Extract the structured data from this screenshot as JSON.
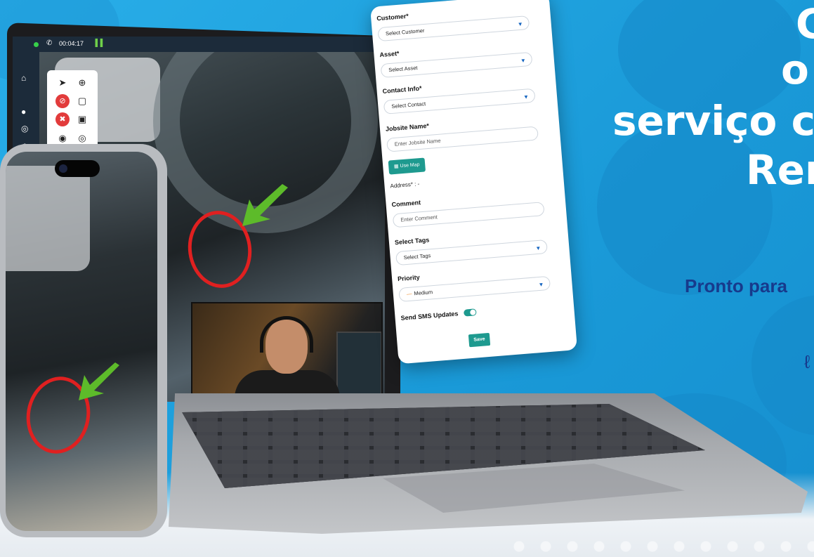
{
  "headline": {
    "line1": "C",
    "line2": "o",
    "line3": "serviço c",
    "line4": "Rer"
  },
  "subheadline": "Pronto para",
  "call": {
    "timer": "00:04:17"
  },
  "form": {
    "customer": {
      "label": "Customer*",
      "value": "Select Customer"
    },
    "asset": {
      "label": "Asset*",
      "value": "Select Asset"
    },
    "contact": {
      "label": "Contact Info*",
      "value": "Select Contact"
    },
    "jobsite": {
      "label": "Jobsite Name*",
      "placeholder": "Enter Jobsite Name"
    },
    "use_map_label": "Use Map",
    "address_text": "Address* : -",
    "comment": {
      "label": "Comment",
      "placeholder": "Enter Comment"
    },
    "tags": {
      "label": "Select Tags",
      "value": "Select Tags"
    },
    "priority": {
      "label": "Priority",
      "value": "Medium",
      "indicator_color": "#f08a24"
    },
    "sms": {
      "label": "Send SMS Updates",
      "enabled": true
    },
    "save_label": "Save",
    "accent_color": "#1e9a8f"
  },
  "toolbox_icons": [
    "pointer-icon",
    "zoom-in-icon",
    "mic-off-icon",
    "chat-icon",
    "video-off-icon",
    "save-icon",
    "location-icon",
    "record-icon"
  ]
}
